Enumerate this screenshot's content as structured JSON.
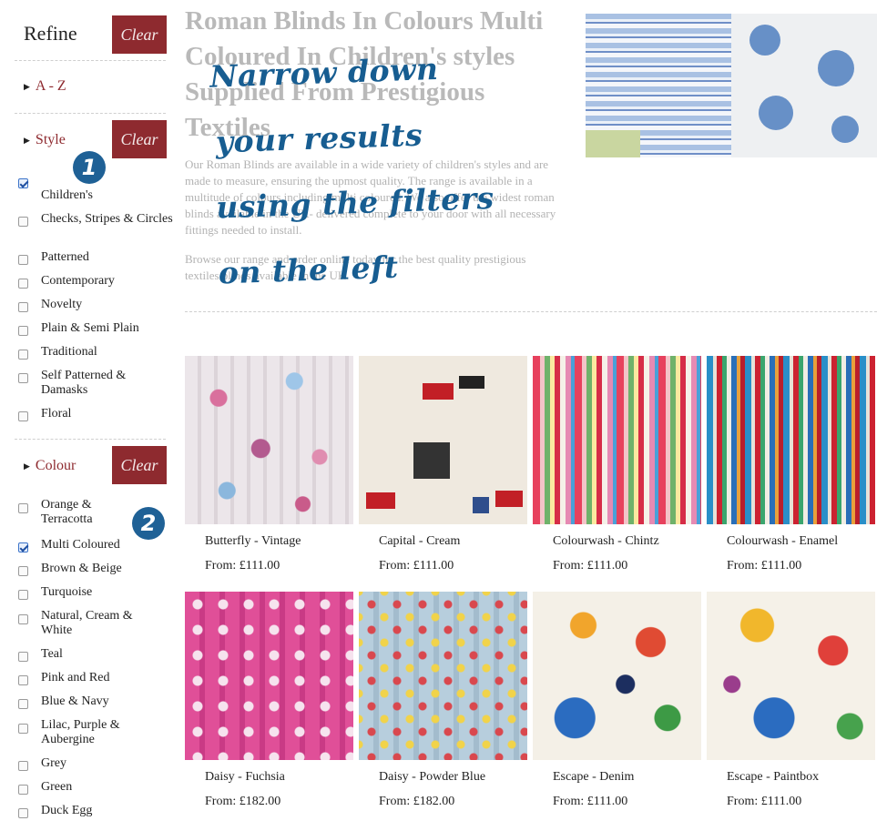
{
  "sidebar": {
    "title": "Refine",
    "clear_label": "Clear",
    "az_label": "A - Z",
    "style": {
      "label": "Style",
      "options": [
        {
          "label": "Children's",
          "checked": true
        },
        {
          "label": "Checks, Stripes & Circles",
          "checked": false
        },
        {
          "label": "Patterned",
          "checked": false
        },
        {
          "label": "Contemporary",
          "checked": false
        },
        {
          "label": "Novelty",
          "checked": false
        },
        {
          "label": "Plain & Semi Plain",
          "checked": false
        },
        {
          "label": "Traditional",
          "checked": false
        },
        {
          "label": "Self Patterned & Damasks",
          "checked": false
        },
        {
          "label": "Floral",
          "checked": false
        }
      ]
    },
    "colour": {
      "label": "Colour",
      "options": [
        {
          "label": "Orange & Terracotta",
          "checked": false
        },
        {
          "label": "Multi Coloured",
          "checked": true
        },
        {
          "label": "Brown & Beige",
          "checked": false
        },
        {
          "label": "Turquoise",
          "checked": false
        },
        {
          "label": "Natural, Cream & White",
          "checked": false
        },
        {
          "label": "Teal",
          "checked": false
        },
        {
          "label": "Pink and Red",
          "checked": false
        },
        {
          "label": "Blue & Navy",
          "checked": false
        },
        {
          "label": "Lilac, Purple & Aubergine",
          "checked": false
        },
        {
          "label": "Grey",
          "checked": false
        },
        {
          "label": "Green",
          "checked": false
        },
        {
          "label": "Duck Egg",
          "checked": false
        }
      ]
    }
  },
  "badges": [
    "1",
    "2"
  ],
  "header": {
    "title": "Roman Blinds In Colours Multi Coloured In Children's styles Supplied From Prestigious Textiles",
    "intro_1": "Our Roman Blinds are available in a wide variety of children's styles and are made to measure, ensuring the upmost quality. The range is available in a multitude of colours including multi coloured. We also offer the widest roman blinds available in the UK- delivered complete to your door with all necessary fittings needed to install.",
    "intro_2": "Browse our range and order online today for the best quality prestigious textiles blinds available in the UK."
  },
  "overlay": {
    "line1": "Narrow down",
    "line2": "your results",
    "line3": "using the filters",
    "line4": "on the left"
  },
  "products": [
    {
      "name": "Butterfly - Vintage",
      "price": "From: £111.00"
    },
    {
      "name": "Capital - Cream",
      "price": "From: £111.00"
    },
    {
      "name": "Colourwash - Chintz",
      "price": "From: £111.00"
    },
    {
      "name": "Colourwash - Enamel",
      "price": "From: £111.00"
    },
    {
      "name": "Daisy - Fuchsia",
      "price": "From: £182.00"
    },
    {
      "name": "Daisy - Powder Blue",
      "price": "From: £182.00"
    },
    {
      "name": "Escape - Denim",
      "price": "From: £111.00"
    },
    {
      "name": "Escape - Paintbox",
      "price": "From: £111.00"
    }
  ],
  "colors": {
    "accent": "#8e2a2f",
    "badge": "#1f6196",
    "overlay_text": "#175d91"
  }
}
